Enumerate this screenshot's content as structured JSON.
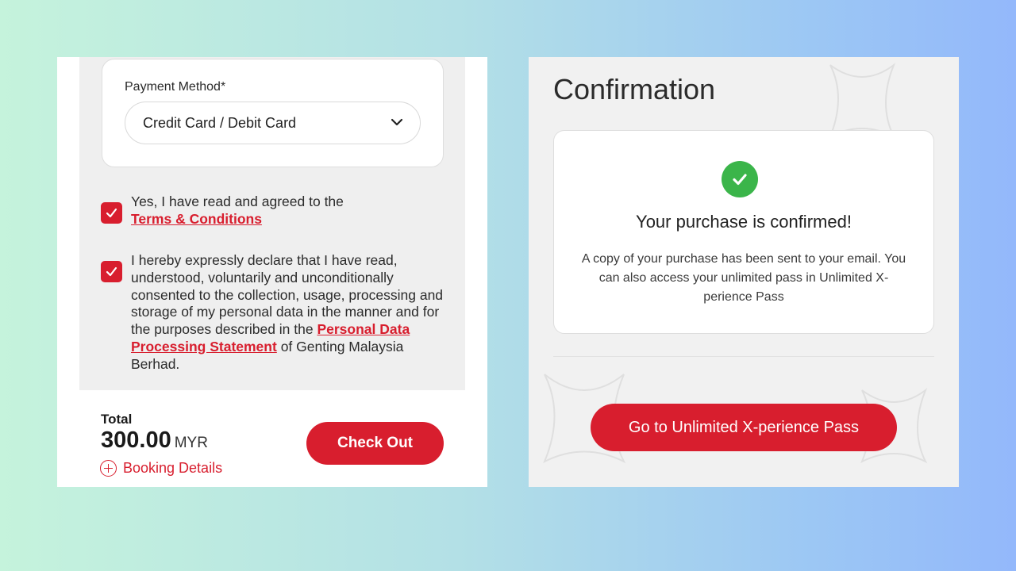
{
  "checkout": {
    "payment_method_label": "Payment Method*",
    "payment_method_value": "Credit Card / Debit Card",
    "terms_text": "Yes, I have read and agreed to the",
    "terms_link": "Terms & Conditions",
    "terms_checked": true,
    "consent_text": "I hereby expressly declare that I have read, understood, voluntarily and unconditionally consented to the collection, usage, processing and storage of my personal data in the manner and for the purposes described in the",
    "consent_link": "Personal Data Processing Statement",
    "consent_suffix": "of Genting Malaysia Berhad.",
    "consent_checked": true,
    "total_label": "Total",
    "total_amount": "300.00",
    "total_currency": "MYR",
    "booking_details_label": "Booking Details",
    "checkout_button": "Check Out"
  },
  "confirmation": {
    "title": "Confirmation",
    "heading": "Your purchase is confirmed!",
    "body": "A copy of your purchase has been sent to your email. You can also access your unlimited pass in Unlimited X-perience Pass",
    "button": "Go to Unlimited X-perience Pass"
  },
  "colors": {
    "accent_red": "#d81e2e",
    "success_green": "#3bb54a"
  },
  "icons": [
    "chevron-down-icon",
    "checkmark-icon",
    "plus-circle-icon",
    "success-check-icon"
  ]
}
